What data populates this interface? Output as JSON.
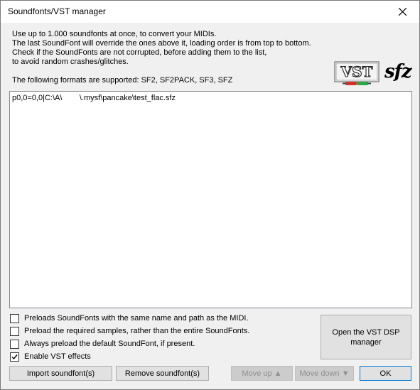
{
  "window": {
    "title": "Soundfonts/VST manager"
  },
  "description": {
    "line1": "Use up to 1.000 soundfonts at once, to convert your MIDIs.",
    "line2": "The last SoundFont will override the ones above it, loading order is from top to bottom.",
    "line3": "Check if the SoundFonts are not corrupted, before adding them to the list,",
    "line4": "to avoid random crashes/glitches.",
    "formats": "The following formats are supported: SF2, SF2PACK, SF3, SFZ"
  },
  "logos": {
    "vst_text": "VST",
    "sfz_text": "sfz"
  },
  "soundfont_list": {
    "items": [
      {
        "text": "p0,0=0,0|C:\\A\\        \\.mysf\\pancake\\test_flac.sfz"
      }
    ]
  },
  "options": {
    "preload_same_name": {
      "label": "Preloads SoundFonts with the same name and path as the MIDI.",
      "checked": false
    },
    "preload_required_samples": {
      "label": "Preload the required samples, rather than the entire SoundFonts.",
      "checked": false
    },
    "always_preload_default": {
      "label": "Always preload the default SoundFont, if present.",
      "checked": false
    },
    "enable_vst": {
      "label": "Enable VST effects",
      "checked": true
    }
  },
  "buttons": {
    "vst_dsp_manager": "Open the VST DSP manager",
    "import": "Import soundfont(s)",
    "remove": "Remove soundfont(s)",
    "move_up": "Move up ▲",
    "move_down": "Move down ▼",
    "ok": "OK"
  }
}
